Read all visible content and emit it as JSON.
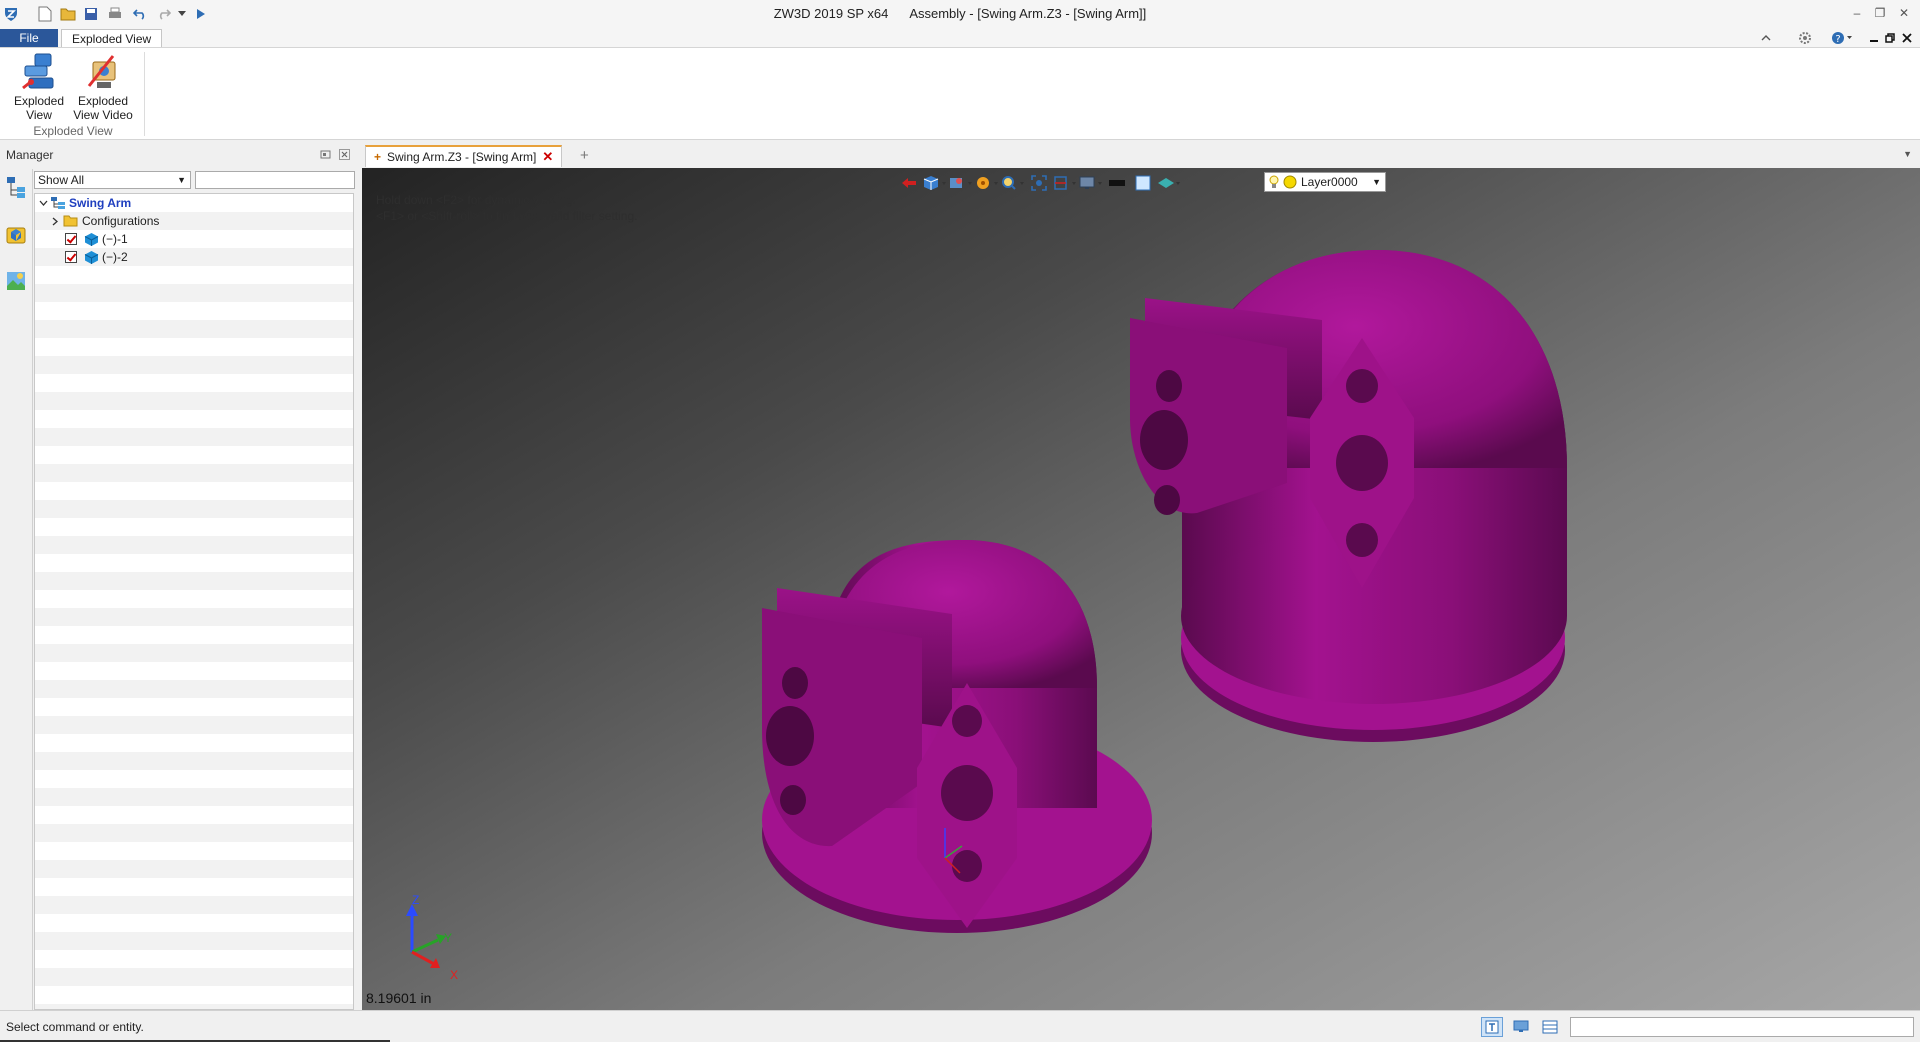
{
  "app": {
    "title": "ZW3D 2019 SP x64      Assembly - [Swing Arm.Z3 - [Swing Arm]]"
  },
  "ribbon": {
    "file_label": "File",
    "active_tab": "Exploded View",
    "buttons": [
      {
        "label": "Exploded View",
        "icon": "exploded-view-icon"
      },
      {
        "label": "Exploded View Video",
        "icon": "exploded-view-video-icon"
      }
    ],
    "group_label": "Exploded View"
  },
  "manager": {
    "title": "Manager",
    "filter": "Show All",
    "search_value": "",
    "tree": [
      {
        "label": "Swing Arm",
        "level": 0,
        "type": "assembly",
        "expanded": true,
        "bold": true,
        "color": "#1f3fbf"
      },
      {
        "label": "Configurations",
        "level": 1,
        "type": "folder",
        "expanded": false
      },
      {
        "label": "(−)-1",
        "level": 1,
        "type": "part",
        "checked": true
      },
      {
        "label": "(−)-2",
        "level": 1,
        "type": "part",
        "checked": true
      }
    ]
  },
  "document": {
    "tab_label": "Swing Arm.Z3 - [Swing Arm]"
  },
  "viewport": {
    "hints": [
      "Hold down <F2> for dynamic viewing.",
      "<F1> or <Shift-roll> to find next valid filter setting."
    ],
    "layer": "Layer0000",
    "axis_labels": {
      "z": "Z",
      "y": "Y",
      "x": "X"
    },
    "measurement": "8.19601 in",
    "part_color": "#8f0f7d"
  },
  "statusbar": {
    "text": "Select command or entity.",
    "input_value": ""
  }
}
